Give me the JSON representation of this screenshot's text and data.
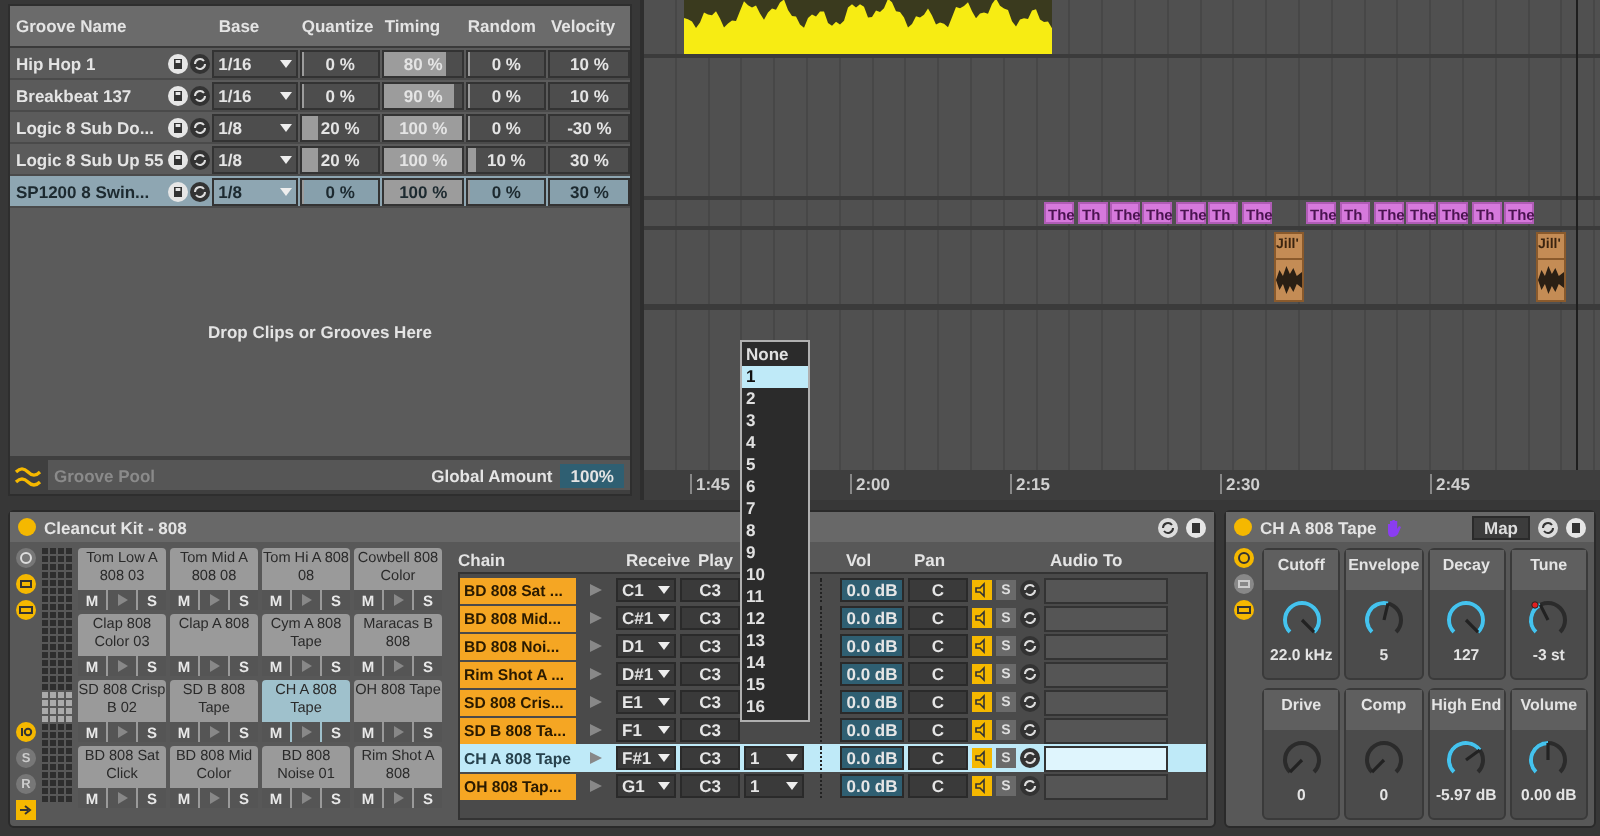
{
  "groove_pool": {
    "columns": [
      "Groove Name",
      "Base",
      "Quantize",
      "Timing",
      "Random",
      "Velocity"
    ],
    "rows": [
      {
        "name": "Hip Hop 1",
        "base": "1/16",
        "quantize": {
          "value": "0 %",
          "level": 0
        },
        "timing": {
          "value": "80 %",
          "level": 0.8
        },
        "random": {
          "value": "0 %",
          "level": 0
        },
        "velocity": "10 %",
        "selected": false
      },
      {
        "name": "Breakbeat 137",
        "base": "1/16",
        "quantize": {
          "value": "0 %",
          "level": 0
        },
        "timing": {
          "value": "90 %",
          "level": 0.9
        },
        "random": {
          "value": "0 %",
          "level": 0
        },
        "velocity": "10 %",
        "selected": false
      },
      {
        "name": "Logic 8 Sub Do...",
        "base": "1/8",
        "quantize": {
          "value": "20 %",
          "level": 0.2
        },
        "timing": {
          "value": "100 %",
          "level": 1
        },
        "random": {
          "value": "0 %",
          "level": 0
        },
        "velocity": "-30 %",
        "selected": false
      },
      {
        "name": "Logic 8 Sub Up 55",
        "base": "1/8",
        "quantize": {
          "value": "20 %",
          "level": 0.2
        },
        "timing": {
          "value": "100 %",
          "level": 1
        },
        "random": {
          "value": "10 %",
          "level": 0.1
        },
        "velocity": "30 %",
        "selected": false
      },
      {
        "name": "SP1200 8 Swin...",
        "base": "1/8",
        "quantize": {
          "value": "0 %",
          "level": 0
        },
        "timing": {
          "value": "100 %",
          "level": 1
        },
        "random": {
          "value": "0 %",
          "level": 0
        },
        "velocity": "30 %",
        "selected": true
      }
    ],
    "drop_hint": "Drop Clips or Grooves Here",
    "title": "Groove Pool",
    "global_amount_label": "Global Amount",
    "global_amount": "100%"
  },
  "arrangement": {
    "midi_clips": [
      {
        "label": "The"
      },
      {
        "label": "Th"
      },
      {
        "label": "The"
      },
      {
        "label": "The"
      },
      {
        "label": "The"
      },
      {
        "label": "Th"
      },
      {
        "label": "The"
      },
      {
        "label": "The"
      },
      {
        "label": "Th"
      },
      {
        "label": "The"
      },
      {
        "label": "The"
      },
      {
        "label": "The"
      },
      {
        "label": "Th"
      },
      {
        "label": "The"
      }
    ],
    "audio_clips": [
      {
        "label": "Jill'"
      },
      {
        "label": "Jill'"
      }
    ],
    "ruler": [
      "1:45",
      "2:00",
      "2:15",
      "2:30",
      "2:45"
    ]
  },
  "choke_menu": {
    "items": [
      {
        "label": "None",
        "selected": false
      },
      {
        "label": "1",
        "selected": true
      },
      {
        "label": "2",
        "selected": false
      },
      {
        "label": "3",
        "selected": false
      },
      {
        "label": "4",
        "selected": false
      },
      {
        "label": "5",
        "selected": false
      },
      {
        "label": "6",
        "selected": false
      },
      {
        "label": "7",
        "selected": false
      },
      {
        "label": "8",
        "selected": false
      },
      {
        "label": "9",
        "selected": false
      },
      {
        "label": "10",
        "selected": false
      },
      {
        "label": "11",
        "selected": false
      },
      {
        "label": "12",
        "selected": false
      },
      {
        "label": "13",
        "selected": false
      },
      {
        "label": "14",
        "selected": false
      },
      {
        "label": "15",
        "selected": false
      },
      {
        "label": "16",
        "selected": false
      }
    ]
  },
  "drum_rack": {
    "title": "Cleancut Kit - 808",
    "side_labels": [
      "S",
      "R"
    ],
    "pads": [
      {
        "name": "Tom Low A 808 03",
        "selected": false,
        "buttons": [
          "M",
          "S"
        ]
      },
      {
        "name": "Tom Mid A 808 08",
        "selected": false,
        "buttons": [
          "M",
          "S"
        ]
      },
      {
        "name": "Tom Hi A 808 08",
        "selected": false,
        "buttons": [
          "M",
          "S"
        ]
      },
      {
        "name": "Cowbell 808 Color",
        "selected": false,
        "buttons": [
          "M",
          "S"
        ]
      },
      {
        "name": "Clap 808 Color 03",
        "selected": false,
        "buttons": [
          "M",
          "S"
        ]
      },
      {
        "name": "Clap A 808",
        "selected": false,
        "buttons": [
          "M",
          "S"
        ]
      },
      {
        "name": "Cym A 808 Tape",
        "selected": false,
        "buttons": [
          "M",
          "S"
        ]
      },
      {
        "name": "Maracas B 808",
        "selected": false,
        "buttons": [
          "M",
          "S"
        ]
      },
      {
        "name": "SD 808 Crisp B 02",
        "selected": false,
        "buttons": [
          "M",
          "S"
        ]
      },
      {
        "name": "SD B 808 Tape",
        "selected": false,
        "buttons": [
          "M",
          "S"
        ]
      },
      {
        "name": "CH A 808 Tape",
        "selected": true,
        "buttons": [
          "M",
          "S"
        ]
      },
      {
        "name": "OH 808 Tape",
        "selected": false,
        "buttons": [
          "M",
          "S"
        ]
      },
      {
        "name": "BD 808 Sat Click",
        "selected": false,
        "buttons": [
          "M",
          "S"
        ]
      },
      {
        "name": "BD 808 Mid Color",
        "selected": false,
        "buttons": [
          "M",
          "S"
        ]
      },
      {
        "name": "BD 808 Noise 01",
        "selected": false,
        "buttons": [
          "M",
          "S"
        ]
      },
      {
        "name": "Rim Shot A 808",
        "selected": false,
        "buttons": [
          "M",
          "S"
        ]
      }
    ],
    "chain_columns": [
      "Chain",
      "Receive",
      "Play",
      "Vol",
      "Pan",
      "Audio To"
    ],
    "chains": [
      {
        "name": "BD 808 Sat ...",
        "receive": "C1",
        "play": "C3",
        "vol": "0.0 dB",
        "pan": "C",
        "solo": "S",
        "selected": false
      },
      {
        "name": "BD 808 Mid...",
        "receive": "C#1",
        "play": "C3",
        "vol": "0.0 dB",
        "pan": "C",
        "solo": "S",
        "selected": false
      },
      {
        "name": "BD 808 Noi...",
        "receive": "D1",
        "play": "C3",
        "vol": "0.0 dB",
        "pan": "C",
        "solo": "S",
        "selected": false
      },
      {
        "name": "Rim Shot A ...",
        "receive": "D#1",
        "play": "C3",
        "vol": "0.0 dB",
        "pan": "C",
        "solo": "S",
        "selected": false
      },
      {
        "name": "SD 808 Cris...",
        "receive": "E1",
        "play": "C3",
        "vol": "0.0 dB",
        "pan": "C",
        "solo": "S",
        "selected": false
      },
      {
        "name": "SD B 808 Ta...",
        "receive": "F1",
        "play": "C3",
        "vol": "0.0 dB",
        "pan": "C",
        "solo": "S",
        "selected": false
      },
      {
        "name": "CH A 808 Tape",
        "receive": "F#1",
        "play": "C3",
        "choke": "1",
        "vol": "0.0 dB",
        "pan": "C",
        "solo": "S",
        "selected": true
      },
      {
        "name": "OH 808 Tap...",
        "receive": "G1",
        "play": "C3",
        "choke": "1",
        "vol": "0.0 dB",
        "pan": "C",
        "solo": "S",
        "selected": false
      }
    ]
  },
  "device": {
    "title": "CH A 808 Tape",
    "map": "Map",
    "knobs": [
      {
        "label": "Cutoff",
        "value": "22.0 kHz",
        "modulated": false
      },
      {
        "label": "Envelope",
        "value": "5",
        "modulated": false
      },
      {
        "label": "Decay",
        "value": "127",
        "modulated": false
      },
      {
        "label": "Tune",
        "value": "-3 st",
        "modulated": true
      },
      {
        "label": "Drive",
        "value": "0",
        "modulated": false
      },
      {
        "label": "Comp",
        "value": "0",
        "modulated": false
      },
      {
        "label": "High End",
        "value": "-5.97 dB",
        "modulated": false
      },
      {
        "label": "Volume",
        "value": "0.00 dB",
        "modulated": false
      }
    ]
  }
}
